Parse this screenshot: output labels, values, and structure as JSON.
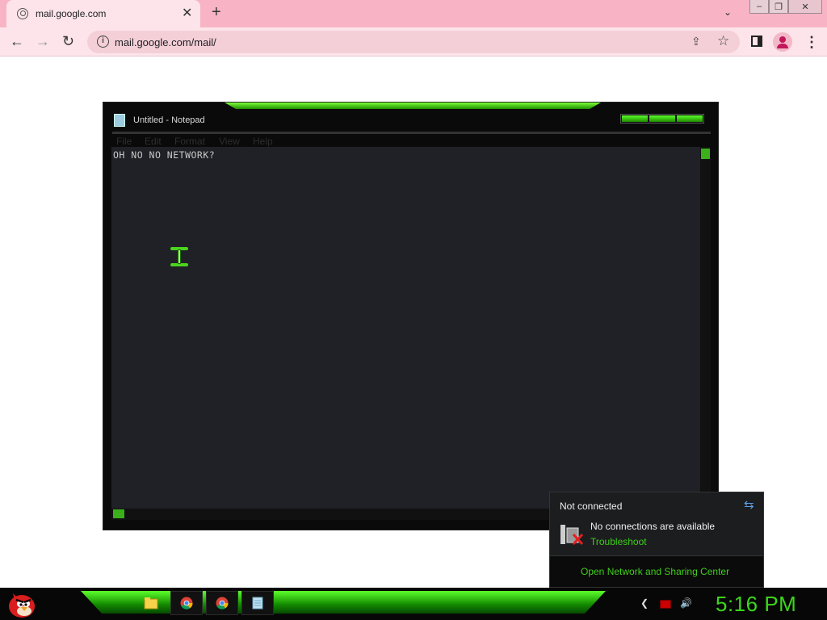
{
  "browser": {
    "tab_title": "mail.google.com",
    "tab_close": "✕",
    "new_tab": "+",
    "tab_list": "⌄",
    "url": "mail.google.com/mail/",
    "url_info": "i",
    "minimize": "‒",
    "restore": "❐",
    "close": "✕",
    "back": "←",
    "forward": "→",
    "reload": "↻",
    "share": "⇪",
    "bookmark": "☆",
    "menu": "⋮"
  },
  "notepad": {
    "title": "Untitled - Notepad",
    "menu": [
      "File",
      "Edit",
      "Format",
      "View",
      "Help"
    ],
    "content": "OH NO NO NETWORK?"
  },
  "network_flyout": {
    "title": "Not connected",
    "refresh": "⇆",
    "message": "No connections are available",
    "troubleshoot": "Troubleshoot",
    "open_center": "Open Network and Sharing Center"
  },
  "taskbar": {
    "clock": "5:16 PM",
    "tray_arrow": "❮",
    "tray_volume": "🔊"
  }
}
